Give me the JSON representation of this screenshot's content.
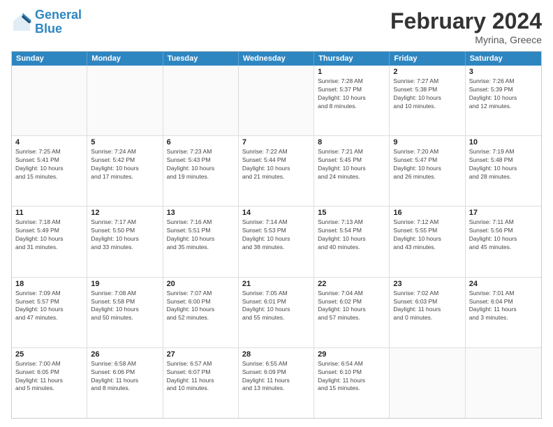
{
  "header": {
    "logo_line1": "General",
    "logo_line2": "Blue",
    "title": "February 2024",
    "location": "Myrina, Greece"
  },
  "days_of_week": [
    "Sunday",
    "Monday",
    "Tuesday",
    "Wednesday",
    "Thursday",
    "Friday",
    "Saturday"
  ],
  "rows": [
    [
      {
        "day": "",
        "empty": true
      },
      {
        "day": "",
        "empty": true
      },
      {
        "day": "",
        "empty": true
      },
      {
        "day": "",
        "empty": true
      },
      {
        "day": "1",
        "info": "Sunrise: 7:28 AM\nSunset: 5:37 PM\nDaylight: 10 hours\nand 8 minutes."
      },
      {
        "day": "2",
        "info": "Sunrise: 7:27 AM\nSunset: 5:38 PM\nDaylight: 10 hours\nand 10 minutes."
      },
      {
        "day": "3",
        "info": "Sunrise: 7:26 AM\nSunset: 5:39 PM\nDaylight: 10 hours\nand 12 minutes."
      }
    ],
    [
      {
        "day": "4",
        "info": "Sunrise: 7:25 AM\nSunset: 5:41 PM\nDaylight: 10 hours\nand 15 minutes."
      },
      {
        "day": "5",
        "info": "Sunrise: 7:24 AM\nSunset: 5:42 PM\nDaylight: 10 hours\nand 17 minutes."
      },
      {
        "day": "6",
        "info": "Sunrise: 7:23 AM\nSunset: 5:43 PM\nDaylight: 10 hours\nand 19 minutes."
      },
      {
        "day": "7",
        "info": "Sunrise: 7:22 AM\nSunset: 5:44 PM\nDaylight: 10 hours\nand 21 minutes."
      },
      {
        "day": "8",
        "info": "Sunrise: 7:21 AM\nSunset: 5:45 PM\nDaylight: 10 hours\nand 24 minutes."
      },
      {
        "day": "9",
        "info": "Sunrise: 7:20 AM\nSunset: 5:47 PM\nDaylight: 10 hours\nand 26 minutes."
      },
      {
        "day": "10",
        "info": "Sunrise: 7:19 AM\nSunset: 5:48 PM\nDaylight: 10 hours\nand 28 minutes."
      }
    ],
    [
      {
        "day": "11",
        "info": "Sunrise: 7:18 AM\nSunset: 5:49 PM\nDaylight: 10 hours\nand 31 minutes."
      },
      {
        "day": "12",
        "info": "Sunrise: 7:17 AM\nSunset: 5:50 PM\nDaylight: 10 hours\nand 33 minutes."
      },
      {
        "day": "13",
        "info": "Sunrise: 7:16 AM\nSunset: 5:51 PM\nDaylight: 10 hours\nand 35 minutes."
      },
      {
        "day": "14",
        "info": "Sunrise: 7:14 AM\nSunset: 5:53 PM\nDaylight: 10 hours\nand 38 minutes."
      },
      {
        "day": "15",
        "info": "Sunrise: 7:13 AM\nSunset: 5:54 PM\nDaylight: 10 hours\nand 40 minutes."
      },
      {
        "day": "16",
        "info": "Sunrise: 7:12 AM\nSunset: 5:55 PM\nDaylight: 10 hours\nand 43 minutes."
      },
      {
        "day": "17",
        "info": "Sunrise: 7:11 AM\nSunset: 5:56 PM\nDaylight: 10 hours\nand 45 minutes."
      }
    ],
    [
      {
        "day": "18",
        "info": "Sunrise: 7:09 AM\nSunset: 5:57 PM\nDaylight: 10 hours\nand 47 minutes."
      },
      {
        "day": "19",
        "info": "Sunrise: 7:08 AM\nSunset: 5:58 PM\nDaylight: 10 hours\nand 50 minutes."
      },
      {
        "day": "20",
        "info": "Sunrise: 7:07 AM\nSunset: 6:00 PM\nDaylight: 10 hours\nand 52 minutes."
      },
      {
        "day": "21",
        "info": "Sunrise: 7:05 AM\nSunset: 6:01 PM\nDaylight: 10 hours\nand 55 minutes."
      },
      {
        "day": "22",
        "info": "Sunrise: 7:04 AM\nSunset: 6:02 PM\nDaylight: 10 hours\nand 57 minutes."
      },
      {
        "day": "23",
        "info": "Sunrise: 7:02 AM\nSunset: 6:03 PM\nDaylight: 11 hours\nand 0 minutes."
      },
      {
        "day": "24",
        "info": "Sunrise: 7:01 AM\nSunset: 6:04 PM\nDaylight: 11 hours\nand 3 minutes."
      }
    ],
    [
      {
        "day": "25",
        "info": "Sunrise: 7:00 AM\nSunset: 6:05 PM\nDaylight: 11 hours\nand 5 minutes."
      },
      {
        "day": "26",
        "info": "Sunrise: 6:58 AM\nSunset: 6:06 PM\nDaylight: 11 hours\nand 8 minutes."
      },
      {
        "day": "27",
        "info": "Sunrise: 6:57 AM\nSunset: 6:07 PM\nDaylight: 11 hours\nand 10 minutes."
      },
      {
        "day": "28",
        "info": "Sunrise: 6:55 AM\nSunset: 6:09 PM\nDaylight: 11 hours\nand 13 minutes."
      },
      {
        "day": "29",
        "info": "Sunrise: 6:54 AM\nSunset: 6:10 PM\nDaylight: 11 hours\nand 15 minutes."
      },
      {
        "day": "",
        "empty": true
      },
      {
        "day": "",
        "empty": true
      }
    ]
  ]
}
